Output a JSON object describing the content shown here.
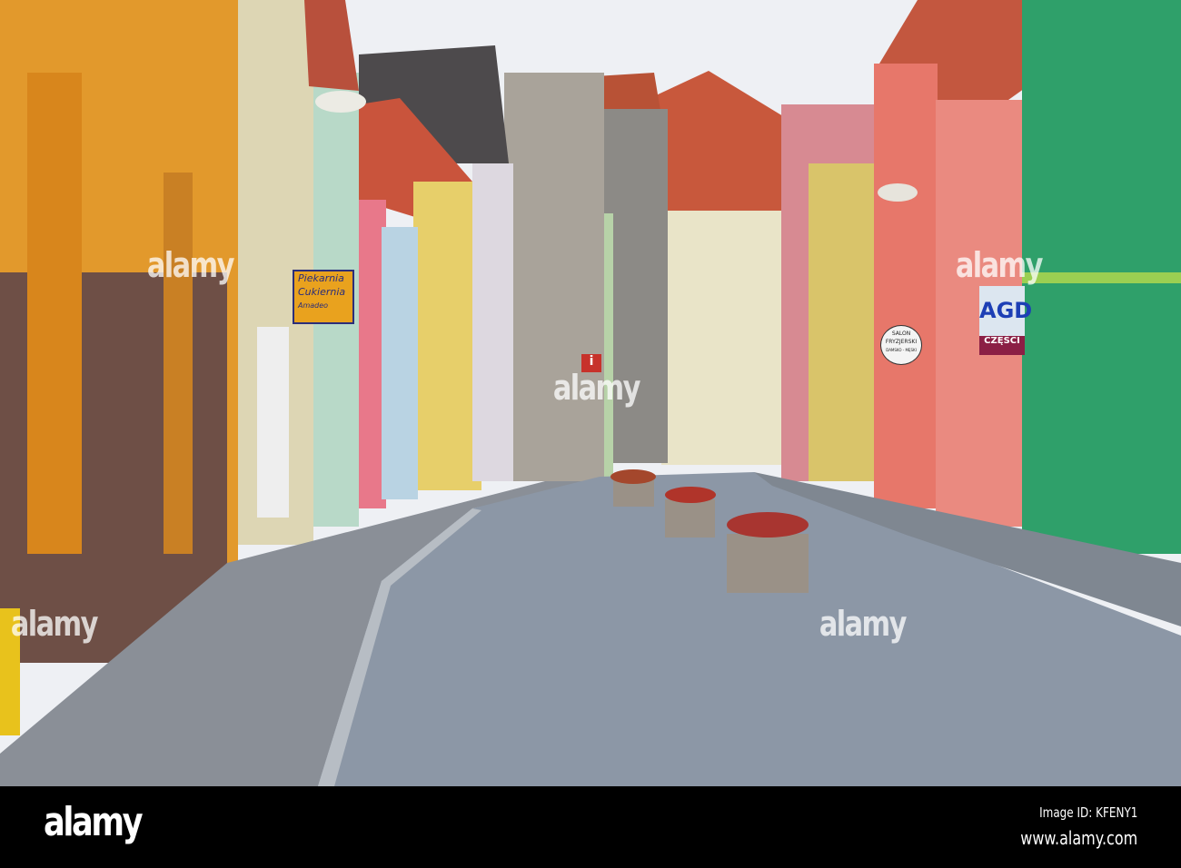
{
  "watermark": {
    "text": "alamy",
    "image_id": "Image ID: KFENY1",
    "url": "www.alamy.com"
  },
  "signs": {
    "bakery": {
      "line1": "Piekarnia",
      "line2": "Cukiernia",
      "line3": "Amadeo"
    },
    "appliance": {
      "main": "AGD",
      "sub": "CZĘŚCI"
    },
    "salon": {
      "line1": "SALON",
      "line2": "FRYZJERSKI",
      "line3": "DAMSKO - MĘSKI"
    },
    "info": {
      "text": "i"
    }
  },
  "colors": {
    "sky": "#eef0f4",
    "cobble": "#8c97a6",
    "green_house": "#2fa06a",
    "pink_house": "#e7776a",
    "orange_house": "#e2992c",
    "roof": "#c8583c"
  }
}
